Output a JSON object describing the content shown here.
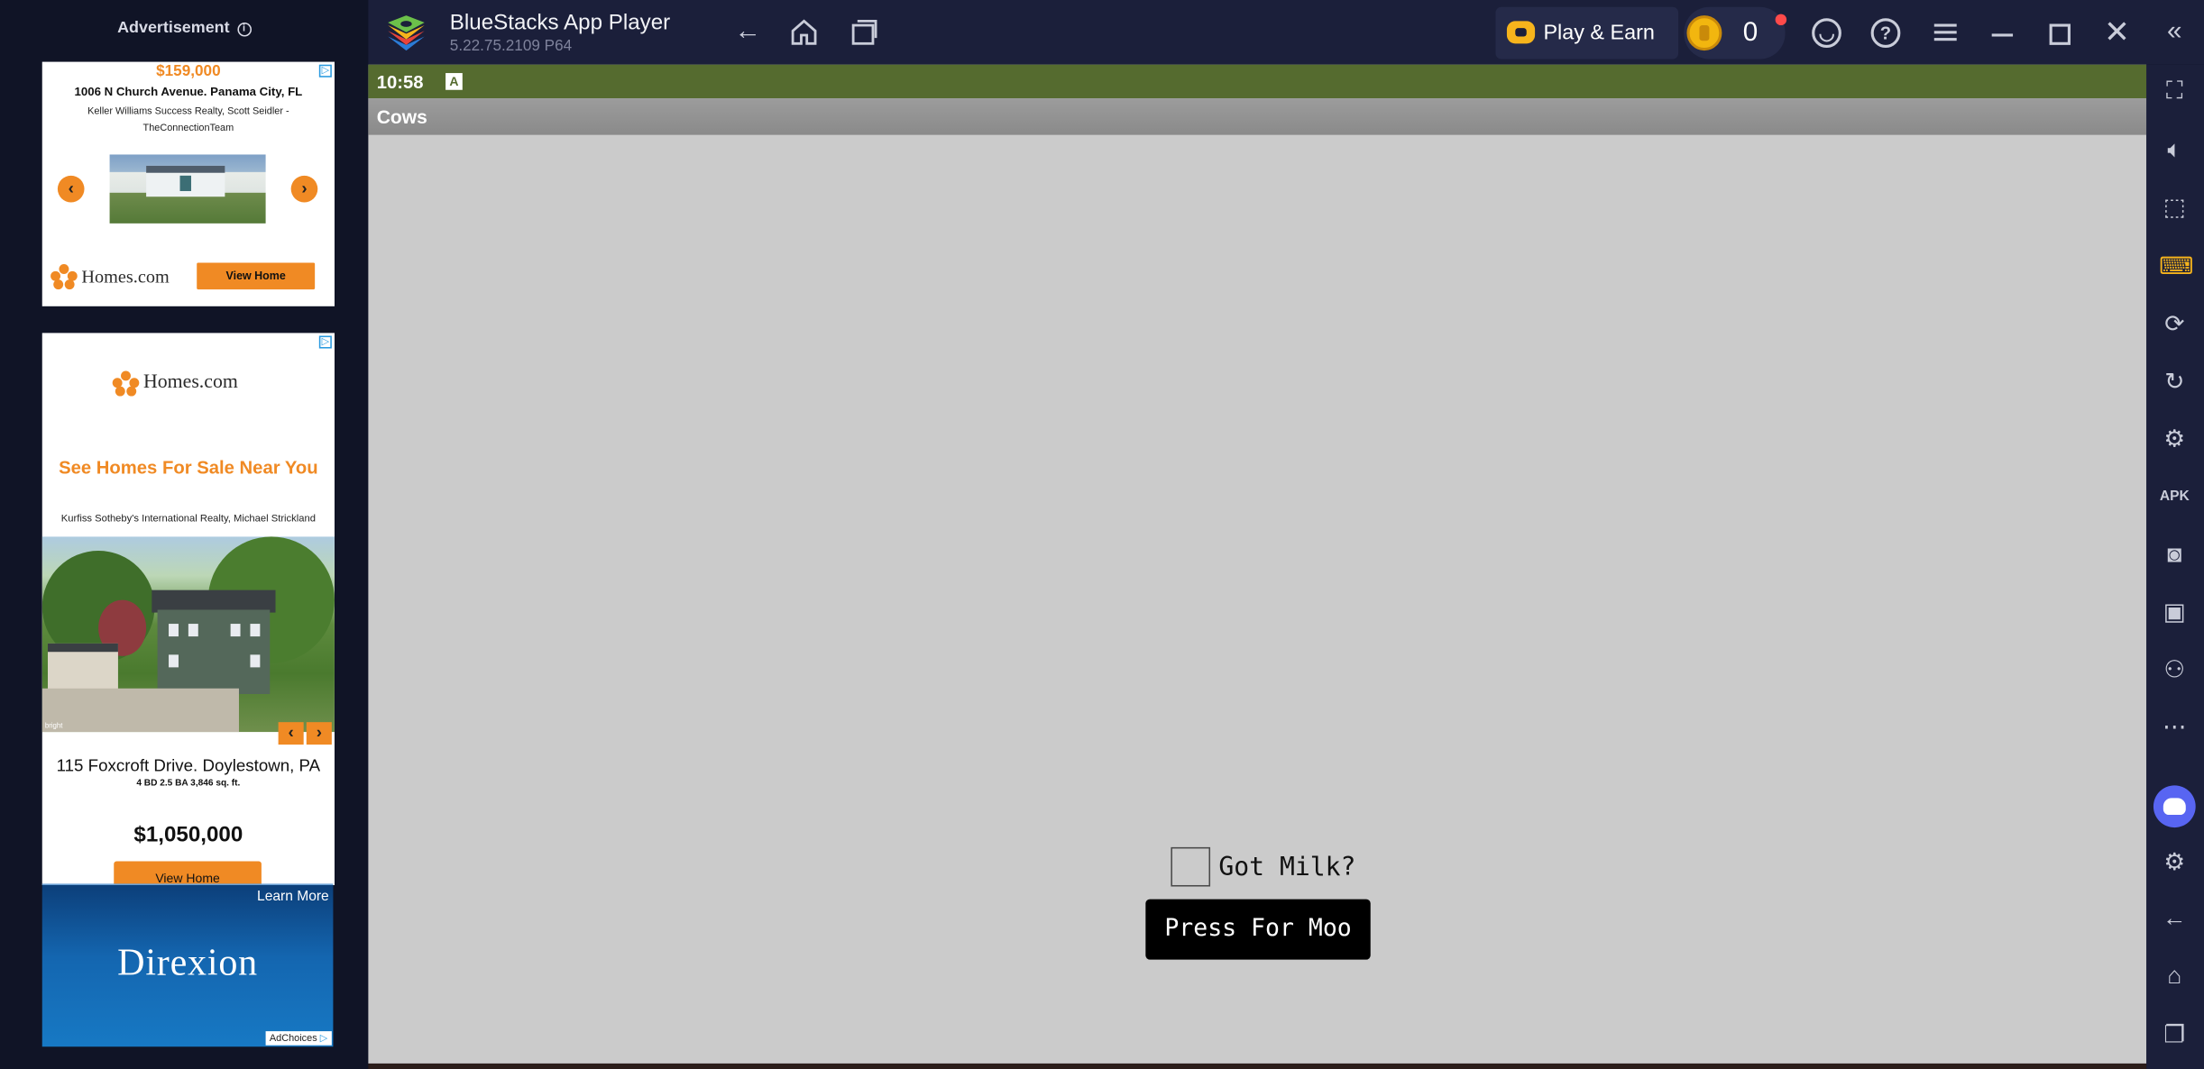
{
  "ads": {
    "header": "Advertisement",
    "ad1": {
      "price": "$159,000",
      "address": "1006 N Church Avenue. Panama City, FL",
      "agent": "Keller Williams Success Realty, Scott Seidler - TheConnectionTeam",
      "brand": "Homes.com",
      "cta": "View Home"
    },
    "ad2": {
      "brand": "Homes.com",
      "headline": "See Homes For Sale Near You",
      "agent": "Kurfiss Sotheby's International Realty, Michael Strickland",
      "street": "115 Foxcroft Drive. Doylestown, PA",
      "specs": "4 BD 2.5 BA 3,846 sq. ft.",
      "price": "$1,050,000",
      "cta": "View Home"
    },
    "ad3": {
      "learn_more": "Learn More",
      "brand": "Direxion",
      "adchoices": "AdChoices"
    }
  },
  "titlebar": {
    "title": "BlueStacks App Player",
    "version": "5.22.75.2109  P64",
    "play_earn": "Play & Earn",
    "coins": "0"
  },
  "android": {
    "time": "10:58",
    "notification_glyph": "A",
    "app_title": "Cows",
    "checkbox_label": "Got Milk?",
    "checkbox_checked": false,
    "button_label": "Press For Moo"
  },
  "colors": {
    "status_bar": "#556b2f",
    "action_bar": "#8f8f8f",
    "app_background": "#cbcbcb",
    "chrome": "#1b1f3a",
    "accent": "#f6b41c",
    "homes_orange": "#f08a24"
  },
  "sidebar_icons": [
    "fullscreen-icon",
    "volume-icon",
    "cursor-icon",
    "keyboard-icon",
    "macro-icon",
    "rotate-icon",
    "gamepad-icon",
    "apk-icon",
    "screenshot-icon",
    "record-icon",
    "eco-icon",
    "more-icon",
    "discord-icon",
    "settings-icon",
    "back-icon",
    "home-icon",
    "recents-icon"
  ]
}
